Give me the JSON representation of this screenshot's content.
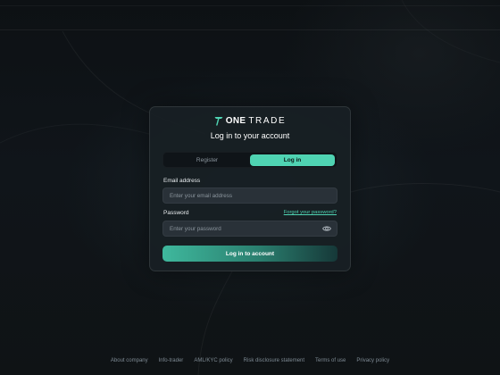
{
  "brand": {
    "name_bold": "ONE",
    "name_light": "TRADE"
  },
  "login": {
    "title": "Log in to your account",
    "tabs": {
      "register": "Register",
      "login": "Log in"
    },
    "email_label": "Email address",
    "email_placeholder": "Enter your email address",
    "password_label": "Password",
    "forgot_link": "Forgot your password?",
    "password_placeholder": "Enter your password",
    "submit_label": "Log in to account"
  },
  "footer": {
    "links": [
      "About company",
      "Info-trader",
      "AML/KYC policy",
      "Risk disclosure statement",
      "Terms of use",
      "Privacy policy"
    ]
  },
  "colors": {
    "accent": "#4fd3b2",
    "background": "#0e1215",
    "card": "#181f24",
    "input": "#293138"
  },
  "icons": {
    "logo": "trade-logo-icon",
    "password_toggle": "eye-icon"
  }
}
